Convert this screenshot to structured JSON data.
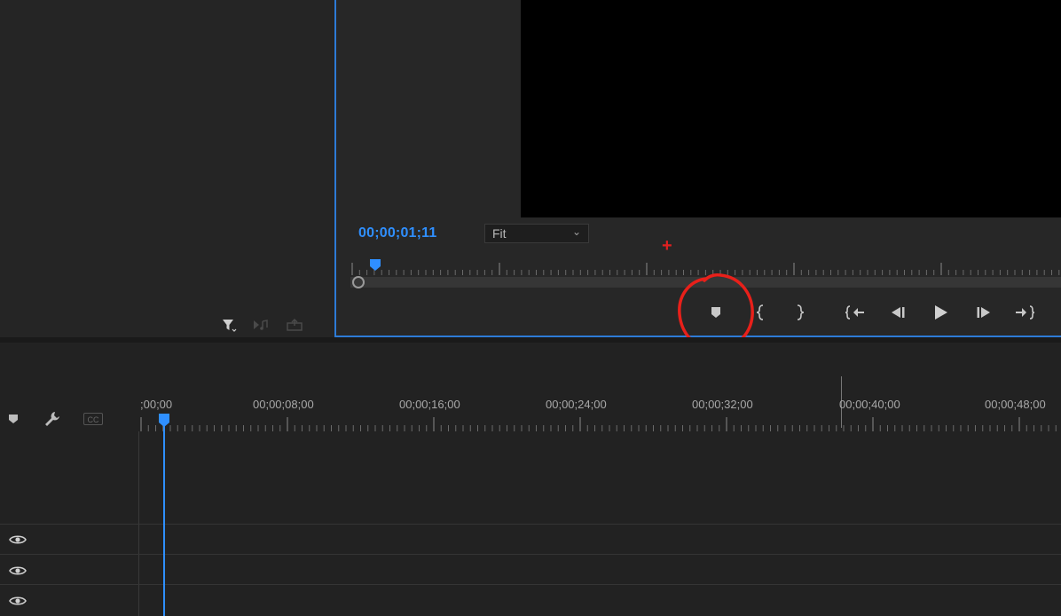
{
  "program_monitor": {
    "timecode": "00;00;01;11",
    "zoom": {
      "selected": "Fit"
    },
    "controls": [
      {
        "name": "add-marker",
        "icon": "marker-icon"
      },
      {
        "name": "mark-in",
        "icon": "mark-in-icon"
      },
      {
        "name": "mark-out",
        "icon": "mark-out-icon"
      },
      {
        "name": "go-to-in",
        "icon": "go-to-in-icon"
      },
      {
        "name": "step-back",
        "icon": "step-back-icon"
      },
      {
        "name": "play",
        "icon": "play-icon"
      },
      {
        "name": "step-forward",
        "icon": "step-forward-icon"
      },
      {
        "name": "go-to-out",
        "icon": "go-to-out-icon"
      }
    ]
  },
  "project_panel": {
    "icons": [
      "filter-icon",
      "automate-to-sequence-icon",
      "find-icon"
    ]
  },
  "timeline": {
    "ruler_labels": [
      ";00;00",
      "00;00;08;00",
      "00;00;16;00",
      "00;00;24;00",
      "00;00;32;00",
      "00;00;40;00",
      "00;00;48;00"
    ],
    "header_icons": [
      "marker-icon",
      "wrench-icon"
    ],
    "cc_label": "CC",
    "tracks": [
      {
        "icon": "eye-icon"
      },
      {
        "icon": "eye-icon"
      },
      {
        "icon": "eye-icon"
      }
    ]
  },
  "colors": {
    "accent": "#2f8fff",
    "annotation": "#e02020",
    "panel_border": "#2d7bd6"
  }
}
